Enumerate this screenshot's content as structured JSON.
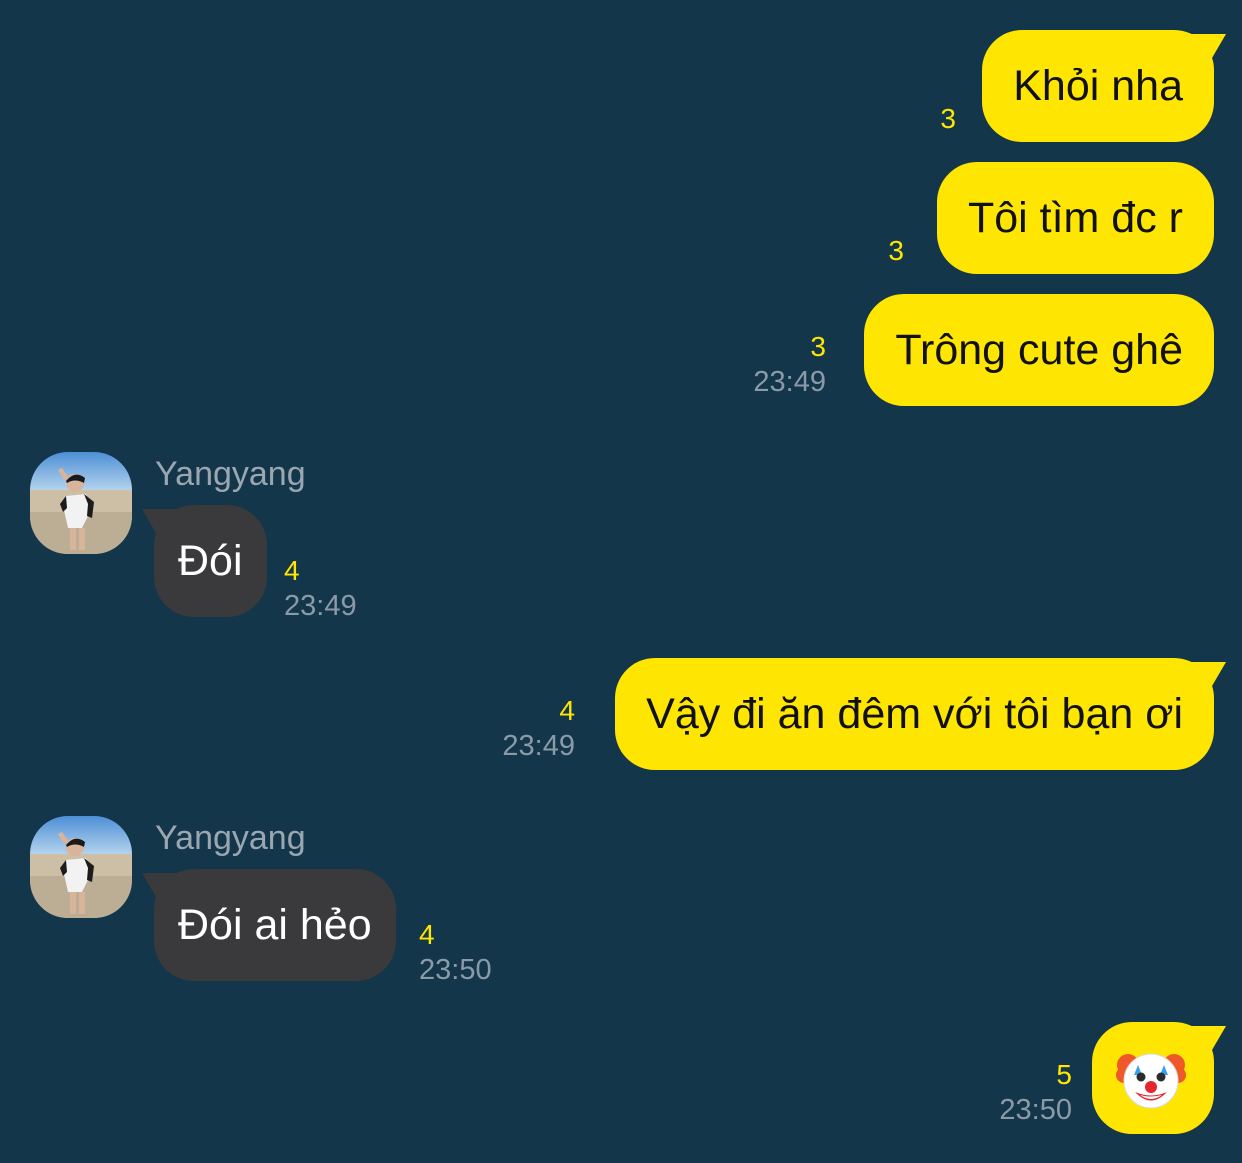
{
  "colors": {
    "background": "#13364a",
    "outgoing_bubble": "#ffe602",
    "incoming_bubble": "#3a3a3c",
    "unread_count": "#ffe602",
    "timestamp": "#8a9aa6"
  },
  "messages": [
    {
      "direction": "outgoing",
      "text": "Khỏi nha",
      "unread": "3",
      "time": ""
    },
    {
      "direction": "outgoing",
      "text": "Tôi tìm đc r",
      "unread": "3",
      "time": ""
    },
    {
      "direction": "outgoing",
      "text": "Trông cute ghê",
      "unread": "3",
      "time": "23:49"
    },
    {
      "direction": "incoming",
      "sender": "Yangyang",
      "avatar_icon": "beach-photo-avatar",
      "text": "Đói",
      "unread": "4",
      "time": "23:49"
    },
    {
      "direction": "outgoing",
      "text": "Vậy đi ăn đêm với tôi bạn ơi",
      "unread": "4",
      "time": "23:49"
    },
    {
      "direction": "incoming",
      "sender": "Yangyang",
      "avatar_icon": "beach-photo-avatar",
      "text": "Đói ai hẻo",
      "unread": "4",
      "time": "23:50"
    },
    {
      "direction": "outgoing",
      "emoji_icon": "clown-face-icon",
      "unread": "5",
      "time": "23:50"
    }
  ]
}
